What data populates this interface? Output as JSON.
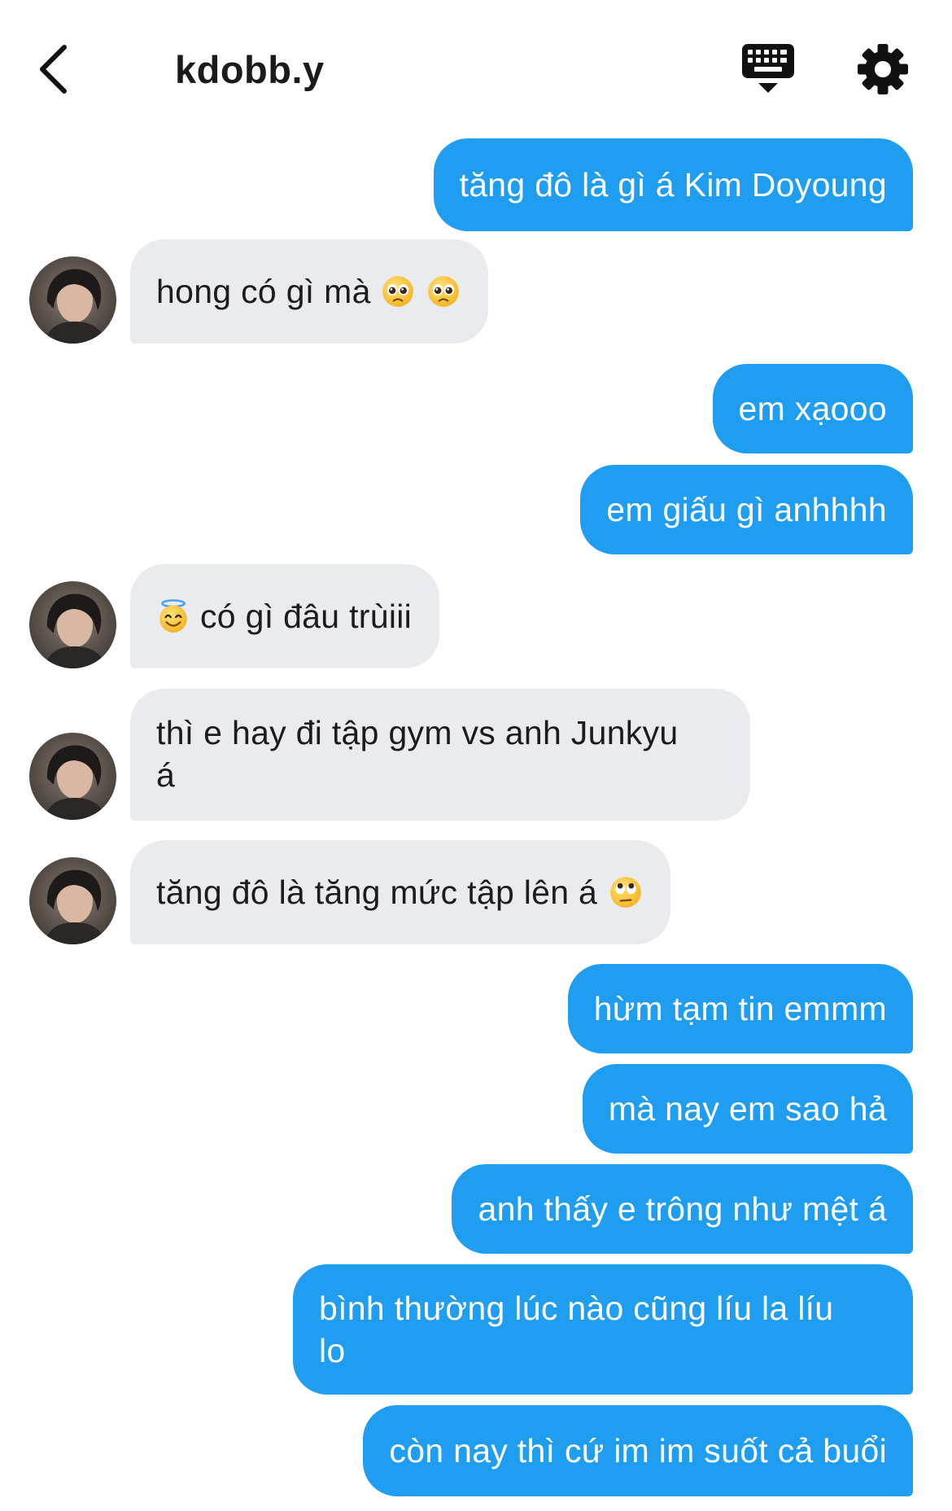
{
  "header": {
    "title": "kdobb.y",
    "back_icon": "chevron-left-icon",
    "keyboard_icon": "keyboard-icon",
    "settings_icon": "gear-icon"
  },
  "colors": {
    "outgoing": "#1f9df0",
    "incoming": "#e9ebee",
    "text_dark": "#1c1c1e"
  },
  "messages": [
    {
      "dir": "out",
      "text": "tăng đô là gì á Kim Doyoung"
    },
    {
      "dir": "in",
      "text": "hong có gì mà",
      "emoji": [
        "pleading-face-icon",
        "pleading-face-icon"
      ]
    },
    {
      "dir": "out",
      "text": "em xạooo"
    },
    {
      "dir": "out",
      "text": "em giấu gì anhhhh"
    },
    {
      "dir": "in",
      "text": "có gì đâu trùiii",
      "emoji_before": "smiling-face-with-halo-icon"
    },
    {
      "dir": "in",
      "lines": [
        "thì e hay đi tập gym vs anh Junkyu",
        "á"
      ]
    },
    {
      "dir": "in",
      "text": "tăng đô là tăng mức tập lên á",
      "emoji": [
        "face-with-rolling-eyes-icon"
      ]
    },
    {
      "dir": "out",
      "text": "hừm tạm tin emmm"
    },
    {
      "dir": "out",
      "text": "mà nay em sao hả"
    },
    {
      "dir": "out",
      "text": "anh thấy e trông như mệt á"
    },
    {
      "dir": "out",
      "lines": [
        "bình thường lúc nào cũng líu la líu",
        "lo"
      ]
    },
    {
      "dir": "out",
      "text": "còn nay thì cứ im im suốt cả buổi"
    }
  ]
}
